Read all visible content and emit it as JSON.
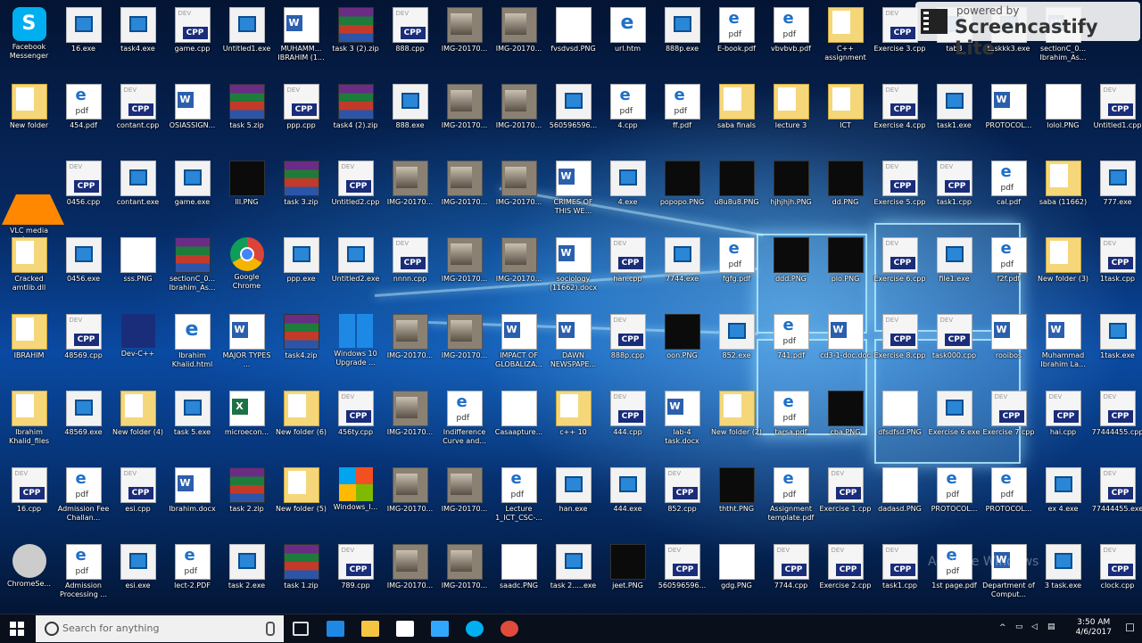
{
  "desktop": {
    "icons": [
      {
        "label": "Facebook Messenger",
        "type": "skype",
        "c": 0,
        "r": 0
      },
      {
        "label": "16.exe",
        "type": "exe",
        "c": 1,
        "r": 0
      },
      {
        "label": "task4.exe",
        "type": "exe",
        "c": 2,
        "r": 0
      },
      {
        "label": "game.cpp",
        "type": "cpp",
        "c": 3,
        "r": 0
      },
      {
        "label": "Untitled1.exe",
        "type": "exe",
        "c": 4,
        "r": 0
      },
      {
        "label": "MUHAMM... IBRAHIM (1...",
        "type": "doc",
        "c": 5,
        "r": 0
      },
      {
        "label": "task 3 (2).zip",
        "type": "zip",
        "c": 6,
        "r": 0
      },
      {
        "label": "888.cpp",
        "type": "cpp",
        "c": 7,
        "r": 0
      },
      {
        "label": "IMG-20170...",
        "type": "img",
        "c": 8,
        "r": 0
      },
      {
        "label": "IMG-20170...",
        "type": "img",
        "c": 9,
        "r": 0
      },
      {
        "label": "fvsdvsd.PNG",
        "type": "png",
        "c": 10,
        "r": 0
      },
      {
        "label": "url.htm",
        "type": "html",
        "c": 11,
        "r": 0
      },
      {
        "label": "888p.exe",
        "type": "exe",
        "c": 12,
        "r": 0
      },
      {
        "label": "E-book.pdf",
        "type": "pdf",
        "c": 13,
        "r": 0
      },
      {
        "label": "vbvbvb.pdf",
        "type": "pdf",
        "c": 14,
        "r": 0
      },
      {
        "label": "C++ assignment",
        "type": "folder",
        "c": 15,
        "r": 0
      },
      {
        "label": "Exercise 3.cpp",
        "type": "cpp",
        "c": 16,
        "r": 0
      },
      {
        "label": "tab3",
        "type": "exe",
        "c": 17,
        "r": 0
      },
      {
        "label": "taskkk3.exe",
        "type": "exe",
        "c": 18,
        "r": 0
      },
      {
        "label": "sectionC_0... Ibrahim_As...",
        "type": "doc",
        "c": 19,
        "r": 0
      },
      {
        "label": "New folder",
        "type": "folder",
        "c": 0,
        "r": 1
      },
      {
        "label": "454.pdf",
        "type": "pdf",
        "c": 1,
        "r": 1
      },
      {
        "label": "contant.cpp",
        "type": "cpp",
        "c": 2,
        "r": 1
      },
      {
        "label": "OSIASSIGN...",
        "type": "doc",
        "c": 3,
        "r": 1
      },
      {
        "label": "task 5.zip",
        "type": "zip",
        "c": 4,
        "r": 1
      },
      {
        "label": "ppp.cpp",
        "type": "cpp",
        "c": 5,
        "r": 1
      },
      {
        "label": "task4 (2).zip",
        "type": "zip",
        "c": 6,
        "r": 1
      },
      {
        "label": "888.exe",
        "type": "exe",
        "c": 7,
        "r": 1
      },
      {
        "label": "IMG-20170...",
        "type": "img",
        "c": 8,
        "r": 1
      },
      {
        "label": "IMG-20170...",
        "type": "img",
        "c": 9,
        "r": 1
      },
      {
        "label": "560596596...",
        "type": "exe",
        "c": 10,
        "r": 1
      },
      {
        "label": "4.cpp",
        "type": "pdf",
        "c": 11,
        "r": 1
      },
      {
        "label": "ff.pdf",
        "type": "pdf",
        "c": 12,
        "r": 1
      },
      {
        "label": "saba finals",
        "type": "folder",
        "c": 13,
        "r": 1
      },
      {
        "label": "lecture 3",
        "type": "folder",
        "c": 14,
        "r": 1
      },
      {
        "label": "ICT",
        "type": "folder",
        "c": 15,
        "r": 1
      },
      {
        "label": "Exercise 4.cpp",
        "type": "cpp",
        "c": 16,
        "r": 1
      },
      {
        "label": "task1.exe",
        "type": "exe",
        "c": 17,
        "r": 1
      },
      {
        "label": "PROTOCOL...",
        "type": "doc",
        "c": 18,
        "r": 1
      },
      {
        "label": "lolol.PNG",
        "type": "png",
        "c": 19,
        "r": 1
      },
      {
        "label": "Untitled1.cpp",
        "type": "cpp",
        "c": 20,
        "r": 1
      },
      {
        "label": "VLC media player",
        "type": "vlc",
        "c": 0,
        "r": 2
      },
      {
        "label": "0456.cpp",
        "type": "cpp",
        "c": 1,
        "r": 2
      },
      {
        "label": "contant.exe",
        "type": "exe",
        "c": 2,
        "r": 2
      },
      {
        "label": "game.exe",
        "type": "exe",
        "c": 3,
        "r": 2
      },
      {
        "label": "lll.PNG",
        "type": "pngdark",
        "c": 4,
        "r": 2
      },
      {
        "label": "task 3.zip",
        "type": "zip",
        "c": 5,
        "r": 2
      },
      {
        "label": "Untitled2.cpp",
        "type": "cpp",
        "c": 6,
        "r": 2
      },
      {
        "label": "IMG-20170...",
        "type": "img",
        "c": 7,
        "r": 2
      },
      {
        "label": "IMG-20170...",
        "type": "img",
        "c": 8,
        "r": 2
      },
      {
        "label": "IMG-20170...",
        "type": "img",
        "c": 9,
        "r": 2
      },
      {
        "label": "CRIMES OF THIS WE...",
        "type": "doc",
        "c": 10,
        "r": 2
      },
      {
        "label": "4.exe",
        "type": "exe",
        "c": 11,
        "r": 2
      },
      {
        "label": "popopo.PNG",
        "type": "pngdark",
        "c": 12,
        "r": 2
      },
      {
        "label": "u8u8u8.PNG",
        "type": "pngdark",
        "c": 13,
        "r": 2
      },
      {
        "label": "hjhjhjh.PNG",
        "type": "pngdark",
        "c": 14,
        "r": 2
      },
      {
        "label": "dd.PNG",
        "type": "pngdark",
        "c": 15,
        "r": 2
      },
      {
        "label": "Exercise 5.cpp",
        "type": "cpp",
        "c": 16,
        "r": 2
      },
      {
        "label": "task1.cpp",
        "type": "cpp",
        "c": 17,
        "r": 2
      },
      {
        "label": "cal.pdf",
        "type": "pdf",
        "c": 18,
        "r": 2
      },
      {
        "label": "saba (11662)",
        "type": "folder",
        "c": 19,
        "r": 2
      },
      {
        "label": "777.exe",
        "type": "exe",
        "c": 20,
        "r": 2
      },
      {
        "label": "Cracked amtlib.dll",
        "type": "folder",
        "c": 0,
        "r": 3
      },
      {
        "label": "0456.exe",
        "type": "exe",
        "c": 1,
        "r": 3
      },
      {
        "label": "sss.PNG",
        "type": "png",
        "c": 2,
        "r": 3
      },
      {
        "label": "sectionC_0... Ibrahim_As...",
        "type": "zip",
        "c": 3,
        "r": 3
      },
      {
        "label": "Google Chrome",
        "type": "chrome",
        "c": 4,
        "r": 3
      },
      {
        "label": "ppp.exe",
        "type": "exe",
        "c": 5,
        "r": 3
      },
      {
        "label": "Untitled2.exe",
        "type": "exe",
        "c": 6,
        "r": 3
      },
      {
        "label": "nnnn.cpp",
        "type": "cpp",
        "c": 7,
        "r": 3
      },
      {
        "label": "IMG-20170...",
        "type": "img",
        "c": 8,
        "r": 3
      },
      {
        "label": "IMG-20170...",
        "type": "img",
        "c": 9,
        "r": 3
      },
      {
        "label": "sociology (11662).docx",
        "type": "doc",
        "c": 10,
        "r": 3
      },
      {
        "label": "han.cpp",
        "type": "cpp",
        "c": 11,
        "r": 3
      },
      {
        "label": "7744.exe",
        "type": "exe",
        "c": 12,
        "r": 3
      },
      {
        "label": "fgfg.pdf",
        "type": "pdf",
        "c": 13,
        "r": 3
      },
      {
        "label": "ddd.PNG",
        "type": "pngdark",
        "c": 14,
        "r": 3
      },
      {
        "label": "plo.PNG",
        "type": "pngdark",
        "c": 15,
        "r": 3
      },
      {
        "label": "Exercise 6.cpp",
        "type": "cpp",
        "c": 16,
        "r": 3
      },
      {
        "label": "file1.exe",
        "type": "exe",
        "c": 17,
        "r": 3
      },
      {
        "label": "f2f.pdf",
        "type": "pdf",
        "c": 18,
        "r": 3
      },
      {
        "label": "New folder (3)",
        "type": "folder",
        "c": 19,
        "r": 3
      },
      {
        "label": "1task.cpp",
        "type": "cpp",
        "c": 20,
        "r": 3
      },
      {
        "label": "IBRAHIM",
        "type": "folder",
        "c": 0,
        "r": 4
      },
      {
        "label": "48569.cpp",
        "type": "cpp",
        "c": 1,
        "r": 4
      },
      {
        "label": "Dev-C++",
        "type": "devc",
        "c": 2,
        "r": 4
      },
      {
        "label": "Ibrahim Khalid.html",
        "type": "html",
        "c": 3,
        "r": 4
      },
      {
        "label": "MAJOR TYPES ...",
        "type": "doc",
        "c": 4,
        "r": 4
      },
      {
        "label": "task4.zip",
        "type": "zip",
        "c": 5,
        "r": 4
      },
      {
        "label": "Windows 10 Upgrade ...",
        "type": "win",
        "c": 6,
        "r": 4
      },
      {
        "label": "IMG-20170...",
        "type": "img",
        "c": 7,
        "r": 4
      },
      {
        "label": "IMG-20170...",
        "type": "img",
        "c": 8,
        "r": 4
      },
      {
        "label": "IMPACT OF GLOBALIZA...",
        "type": "doc",
        "c": 9,
        "r": 4
      },
      {
        "label": "DAWN NEWSPAPE...",
        "type": "doc",
        "c": 10,
        "r": 4
      },
      {
        "label": "888p.cpp",
        "type": "cpp",
        "c": 11,
        "r": 4
      },
      {
        "label": "oon.PNG",
        "type": "pngdark",
        "c": 12,
        "r": 4
      },
      {
        "label": "852.exe",
        "type": "exe",
        "c": 13,
        "r": 4
      },
      {
        "label": "741.pdf",
        "type": "pdf",
        "c": 14,
        "r": 4
      },
      {
        "label": "cd3-1-doc.doc",
        "type": "doc",
        "c": 15,
        "r": 4
      },
      {
        "label": "Exercise 8.cpp",
        "type": "cpp",
        "c": 16,
        "r": 4
      },
      {
        "label": "task000.cpp",
        "type": "cpp",
        "c": 17,
        "r": 4
      },
      {
        "label": "rooibos",
        "type": "doc",
        "c": 18,
        "r": 4
      },
      {
        "label": "Muhammad Ibrahim La...",
        "type": "doc",
        "c": 19,
        "r": 4
      },
      {
        "label": "1task.exe",
        "type": "exe",
        "c": 20,
        "r": 4
      },
      {
        "label": "Ibrahim Khalid_files",
        "type": "folder",
        "c": 0,
        "r": 5
      },
      {
        "label": "48569.exe",
        "type": "exe",
        "c": 1,
        "r": 5
      },
      {
        "label": "New folder (4)",
        "type": "folder",
        "c": 2,
        "r": 5
      },
      {
        "label": "task 5.exe",
        "type": "exe",
        "c": 3,
        "r": 5
      },
      {
        "label": "microecon...",
        "type": "xls",
        "c": 4,
        "r": 5
      },
      {
        "label": "New folder (6)",
        "type": "folder",
        "c": 5,
        "r": 5
      },
      {
        "label": "456ty.cpp",
        "type": "cpp",
        "c": 6,
        "r": 5
      },
      {
        "label": "IMG-20170...",
        "type": "img",
        "c": 7,
        "r": 5
      },
      {
        "label": "Indifference Curve and...",
        "type": "pdf",
        "c": 8,
        "r": 5
      },
      {
        "label": "Casaapture...",
        "type": "png",
        "c": 9,
        "r": 5
      },
      {
        "label": "c++ 10",
        "type": "folder",
        "c": 10,
        "r": 5
      },
      {
        "label": "444.cpp",
        "type": "cpp",
        "c": 11,
        "r": 5
      },
      {
        "label": "lab-4 task.docx",
        "type": "doc",
        "c": 12,
        "r": 5
      },
      {
        "label": "New folder (2)",
        "type": "folder",
        "c": 13,
        "r": 5
      },
      {
        "label": "tarsa.pdf",
        "type": "pdf",
        "c": 14,
        "r": 5
      },
      {
        "label": "cba.PNG",
        "type": "pngdark",
        "c": 15,
        "r": 5
      },
      {
        "label": "dfsdfsd.PNG",
        "type": "png",
        "c": 16,
        "r": 5
      },
      {
        "label": "Exercise 6.exe",
        "type": "exe",
        "c": 17,
        "r": 5
      },
      {
        "label": "Exercise 7.cpp",
        "type": "cpp",
        "c": 18,
        "r": 5
      },
      {
        "label": "hai.cpp",
        "type": "cpp",
        "c": 19,
        "r": 5
      },
      {
        "label": "77444455.cpp",
        "type": "cpp",
        "c": 20,
        "r": 5
      },
      {
        "label": "16.cpp",
        "type": "cpp",
        "c": 0,
        "r": 6
      },
      {
        "label": "Admission Fee Challan...",
        "type": "pdf",
        "c": 1,
        "r": 6
      },
      {
        "label": "esi.cpp",
        "type": "cpp",
        "c": 2,
        "r": 6
      },
      {
        "label": "Ibrahim.docx",
        "type": "doc",
        "c": 3,
        "r": 6
      },
      {
        "label": "task 2.zip",
        "type": "zip",
        "c": 4,
        "r": 6
      },
      {
        "label": "New folder (5)",
        "type": "folder",
        "c": 5,
        "r": 6
      },
      {
        "label": "Windows_I...",
        "type": "winlogo",
        "c": 6,
        "r": 6
      },
      {
        "label": "IMG-20170...",
        "type": "img",
        "c": 7,
        "r": 6
      },
      {
        "label": "IMG-20170...",
        "type": "img",
        "c": 8,
        "r": 6
      },
      {
        "label": "Lecture 1_ICT_CSC-...",
        "type": "pdf",
        "c": 9,
        "r": 6
      },
      {
        "label": "han.exe",
        "type": "exe",
        "c": 10,
        "r": 6
      },
      {
        "label": "444.exe",
        "type": "exe",
        "c": 11,
        "r": 6
      },
      {
        "label": "852.cpp",
        "type": "cpp",
        "c": 12,
        "r": 6
      },
      {
        "label": "ththt.PNG",
        "type": "pngdark",
        "c": 13,
        "r": 6
      },
      {
        "label": "Assignment template.pdf",
        "type": "pdf",
        "c": 14,
        "r": 6
      },
      {
        "label": "Exercise 1.cpp",
        "type": "cpp",
        "c": 15,
        "r": 6
      },
      {
        "label": "dadasd.PNG",
        "type": "png",
        "c": 16,
        "r": 6
      },
      {
        "label": "PROTOCOL...",
        "type": "pdf",
        "c": 17,
        "r": 6
      },
      {
        "label": "PROTOCOL...",
        "type": "pdf",
        "c": 18,
        "r": 6
      },
      {
        "label": "ex 4.exe",
        "type": "exe",
        "c": 19,
        "r": 6
      },
      {
        "label": "77444455.exe",
        "type": "cpp",
        "c": 20,
        "r": 6
      },
      {
        "label": "ChromeSe...",
        "type": "cd",
        "c": 0,
        "r": 7
      },
      {
        "label": "Admission Processing ...",
        "type": "pdf",
        "c": 1,
        "r": 7
      },
      {
        "label": "esi.exe",
        "type": "exe",
        "c": 2,
        "r": 7
      },
      {
        "label": "lect-2.PDF",
        "type": "pdf",
        "c": 3,
        "r": 7
      },
      {
        "label": "task 2.exe",
        "type": "exe",
        "c": 4,
        "r": 7
      },
      {
        "label": "task 1.zip",
        "type": "zip",
        "c": 5,
        "r": 7
      },
      {
        "label": "789.cpp",
        "type": "cpp",
        "c": 6,
        "r": 7
      },
      {
        "label": "IMG-20170...",
        "type": "img",
        "c": 7,
        "r": 7
      },
      {
        "label": "IMG-20170...",
        "type": "img",
        "c": 8,
        "r": 7
      },
      {
        "label": "saadc.PNG",
        "type": "png",
        "c": 9,
        "r": 7
      },
      {
        "label": "task 2.....exe",
        "type": "exe",
        "c": 10,
        "r": 7
      },
      {
        "label": "jeet.PNG",
        "type": "pngdark",
        "c": 11,
        "r": 7
      },
      {
        "label": "560596596...",
        "type": "cpp",
        "c": 12,
        "r": 7
      },
      {
        "label": "gdg.PNG",
        "type": "png",
        "c": 13,
        "r": 7
      },
      {
        "label": "7744.cpp",
        "type": "cpp",
        "c": 14,
        "r": 7
      },
      {
        "label": "Exercise 2.cpp",
        "type": "cpp",
        "c": 15,
        "r": 7
      },
      {
        "label": "task1.cpp",
        "type": "cpp",
        "c": 16,
        "r": 7
      },
      {
        "label": "1st page.pdf",
        "type": "pdf",
        "c": 17,
        "r": 7
      },
      {
        "label": "Department of Comput...",
        "type": "doc",
        "c": 18,
        "r": 7
      },
      {
        "label": "3 task.exe",
        "type": "exe",
        "c": 19,
        "r": 7
      },
      {
        "label": "clock.cpp",
        "type": "cpp",
        "c": 20,
        "r": 7
      }
    ]
  },
  "watermark": {
    "top": "powered by",
    "main": "Screencastify Lite"
  },
  "activate_text": "Activate Windows",
  "taskbar": {
    "search_placeholder": "Search for anything",
    "time": "3:50 AM",
    "date": "4/6/2017",
    "pinned": [
      {
        "name": "task-view-icon"
      },
      {
        "name": "edge-icon"
      },
      {
        "name": "file-explorer-icon"
      },
      {
        "name": "store-icon"
      },
      {
        "name": "photoshop-icon"
      },
      {
        "name": "skype-icon"
      },
      {
        "name": "chrome-icon"
      }
    ]
  }
}
